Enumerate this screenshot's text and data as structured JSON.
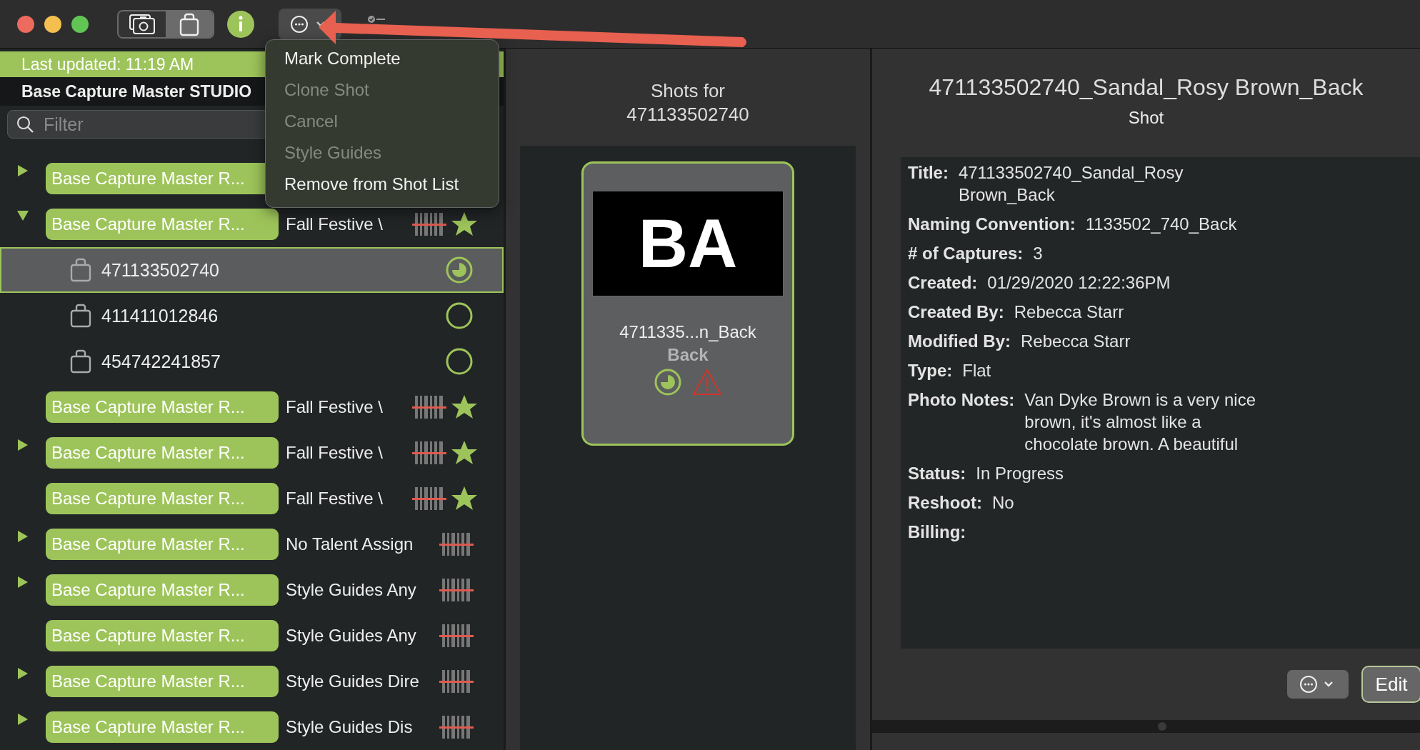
{
  "toolbar": {
    "segments": [
      {
        "selected": true
      },
      {
        "selected": false
      }
    ]
  },
  "sidebar": {
    "last_updated": "Last updated: 11:19 AM",
    "project_title": "Base Capture Master STUDIO",
    "filter": {
      "placeholder": "Filter"
    },
    "groups": [
      {
        "label": "Base Capture Master R...",
        "expanded": false
      },
      {
        "label": "Base Capture Master R...",
        "expanded": true,
        "subtitle": "Fall Festive \\",
        "barcode": true,
        "starred": true,
        "children": [
          {
            "label": "471133502740",
            "started": true,
            "selected": true
          },
          {
            "label": "411411012846",
            "started": false,
            "selected": false
          },
          {
            "label": "454742241857",
            "started": false,
            "selected": false
          }
        ]
      },
      {
        "label": "Base Capture Master R...",
        "subtitle": "Fall Festive \\",
        "barcode": true,
        "starred": true
      },
      {
        "label": "Base Capture Master R...",
        "expanded": false,
        "subtitle": "Fall Festive \\",
        "barcode": true,
        "starred": true
      },
      {
        "label": "Base Capture Master R...",
        "subtitle": "Fall Festive \\",
        "barcode": true,
        "starred": true
      },
      {
        "label": "Base Capture Master R...",
        "expanded": false,
        "subtitle": "No Talent Assign",
        "barcode": true,
        "starred": false
      },
      {
        "label": "Base Capture Master R...",
        "expanded": false,
        "subtitle": "Style Guides Any",
        "barcode": true,
        "starred": false
      },
      {
        "label": "Base Capture Master R...",
        "subtitle": "Style Guides Any",
        "barcode": true,
        "starred": false
      },
      {
        "label": "Base Capture Master R...",
        "expanded": false,
        "subtitle": "Style Guides Dire",
        "barcode": true,
        "starred": false
      },
      {
        "label": "Base Capture Master R...",
        "expanded": false,
        "subtitle": "Style Guides Dis",
        "barcode": true,
        "starred": false
      }
    ]
  },
  "menu": [
    {
      "label": "Mark Complete",
      "disabled": false
    },
    {
      "label": "Clone Shot",
      "disabled": true
    },
    {
      "label": "Cancel",
      "disabled": true
    },
    {
      "label": "Style Guides",
      "disabled": true
    },
    {
      "label": "Remove from Shot List",
      "disabled": false
    }
  ],
  "shots": {
    "heading": "Shots for",
    "product_id": "471133502740",
    "cards": [
      {
        "thumb_text": "BA",
        "name": "4711335...n_Back",
        "view": "Back",
        "started": true,
        "warning": true,
        "selected": true
      }
    ]
  },
  "detail": {
    "title": "471133502740_Sandal_Rosy Brown_Back",
    "subtitle": "Shot",
    "fields": [
      {
        "label": "Title:",
        "value": "471133502740_Sandal_Rosy\nBrown_Back"
      },
      {
        "label": "Naming Convention:",
        "value": "1133502_740_Back"
      },
      {
        "label": "# of Captures:",
        "value": "3"
      },
      {
        "label": "Created:",
        "value": "01/29/2020 12:22:36PM"
      },
      {
        "label": "Created By:",
        "value": "Rebecca Starr"
      },
      {
        "label": "Modified By:",
        "value": "Rebecca Starr"
      },
      {
        "label": "Type:",
        "value": "Flat"
      },
      {
        "label": "Photo Notes:",
        "value": "Van Dyke Brown is a very nice\nbrown, it's almost like a\nchocolate brown. A beautiful"
      },
      {
        "label": "Status:",
        "value": "In Progress"
      },
      {
        "label": "Reshoot:",
        "value": "No"
      },
      {
        "label": "Billing:"
      }
    ],
    "edit_button": "Edit"
  }
}
